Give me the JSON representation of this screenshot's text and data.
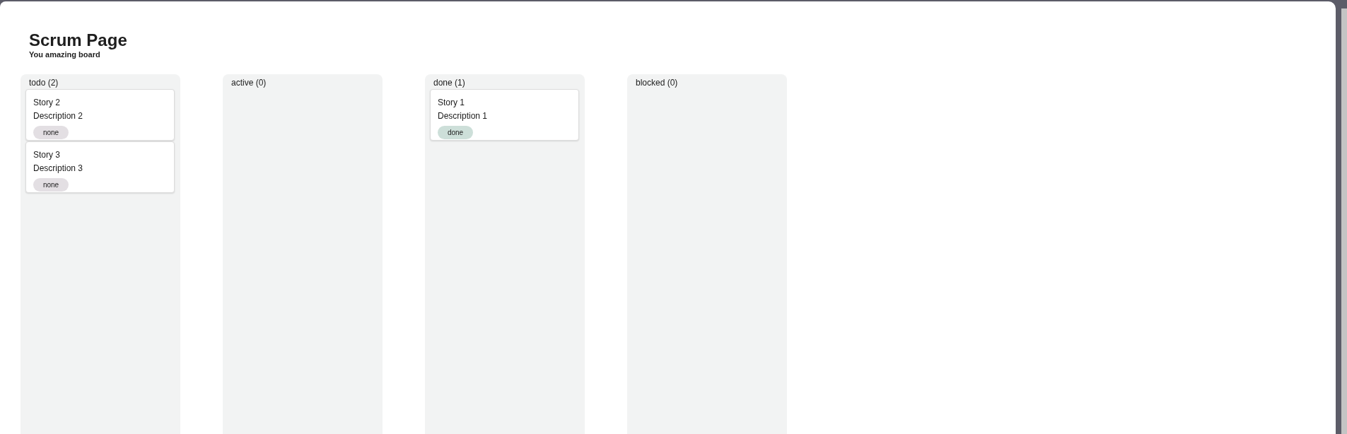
{
  "header": {
    "title": "Scrum Page",
    "subtitle": "You amazing board"
  },
  "columns": [
    {
      "title": "todo (2)",
      "cards": [
        {
          "title": "Story 2",
          "description": "Description 2",
          "tag": {
            "label": "none",
            "color": "#e3dfe3"
          }
        },
        {
          "title": "Story 3",
          "description": "Description 3",
          "tag": {
            "label": "none",
            "color": "#e3dfe3"
          }
        }
      ]
    },
    {
      "title": "active (0)"
    },
    {
      "title": "done (1)",
      "cards": [
        {
          "title": "Story 1",
          "description": "Description 1",
          "tag": {
            "label": "done",
            "color": "#cddfd9"
          }
        }
      ]
    },
    {
      "title": "blocked (0)"
    }
  ]
}
